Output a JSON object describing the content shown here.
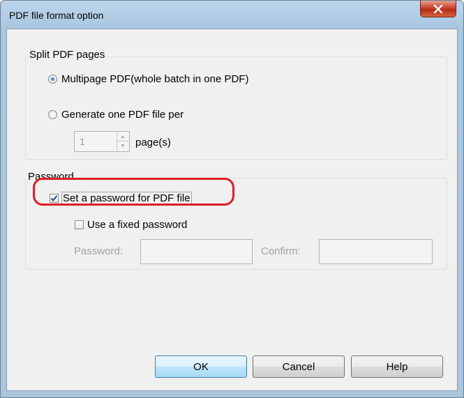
{
  "window": {
    "title": "PDF file format option",
    "close_symbol": "x"
  },
  "split_group": {
    "label": "Split PDF pages",
    "multipage_label": "Multipage PDF(whole batch in one PDF)",
    "multipage_selected": true,
    "per_page_label": "Generate one PDF file per",
    "per_page_selected": false,
    "pages_value": "1",
    "pages_unit": "page(s)"
  },
  "password_group": {
    "label": "Password",
    "set_password_label": "Set a password for PDF file",
    "set_password_checked": true,
    "fixed_password_label": "Use a fixed password",
    "fixed_password_checked": false,
    "password_label": "Password:",
    "confirm_label": "Confirm:"
  },
  "buttons": {
    "ok": "OK",
    "cancel": "Cancel",
    "help": "Help"
  },
  "colors": {
    "highlight": "#e01c24",
    "checkmark": "#1d4f9a"
  }
}
